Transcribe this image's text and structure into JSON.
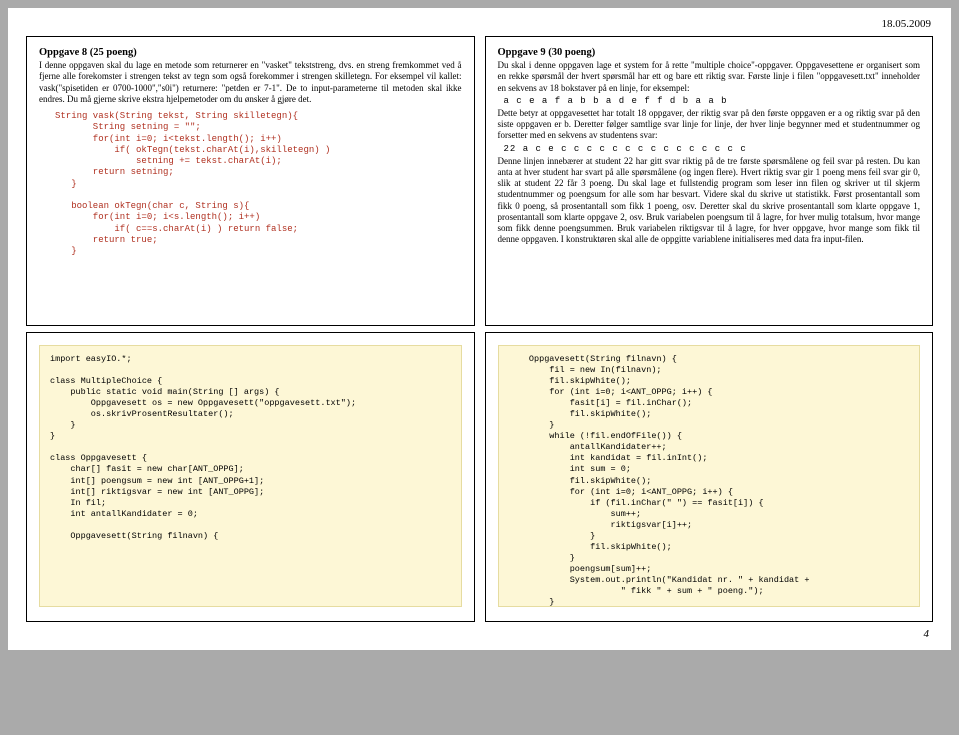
{
  "header": {
    "date": "18.05.2009"
  },
  "pagenum": "4",
  "slide8": {
    "title": "Oppgave 8 (25 poeng)",
    "para": "I denne oppgaven skal du lage en metode som returnerer en \"vasket\" tekststreng, dvs. en streng fremkommet ved å fjerne alle forekomster i strengen tekst av tegn som også forekommer i strengen skilletegn. For eksempel vil kallet: vask(\"spisetiden er 0700-1000\",\"s0i\") returnere: \"petden er 7-1\". De to input-parameterne til metoden skal ikke endres. Du må gjerne skrive ekstra hjelpemetoder om du ønsker å gjøre det.",
    "code": "String vask(String tekst, String skilletegn){\n       String setning = \"\";\n       for(int i=0; i<tekst.length(); i++)\n           if( okTegn(tekst.charAt(i),skilletegn) )\n               setning += tekst.charAt(i);\n       return setning;\n   }\n\n   boolean okTegn(char c, String s){\n       for(int i=0; i<s.length(); i++)\n           if( c==s.charAt(i) ) return false;\n       return true;\n   }"
  },
  "slide9": {
    "title": "Oppgave 9  (30 poeng)",
    "p1": "Du skal i denne oppgaven lage et system for å rette \"multiple choice\"-oppgaver. Oppgavesettene er organisert som en rekke spørsmål der hvert spørsmål har ett og bare ett riktig svar. Første linje i filen \"oppgavesett.txt\" inneholder en sekvens av 18 bokstaver på en linje, for eksempel:",
    "seq1": "a c e a f a b b a d e f f d b a a b",
    "p2": "Dette betyr at oppgavesettet har totalt 18 oppgaver, der riktig svar på den første oppgaven er a og riktig svar på den siste oppgaven er b. Deretter følger samtlige svar linje for linje, der hver linje begynner med et studentnummer og forsetter med en sekvens av studentens svar:",
    "seq2": " 22 a c e c c c c c c c c c c c c c c c",
    "p3": "Denne linjen innebærer at student 22 har gitt svar riktig på de tre første spørsmålene og feil svar på resten. Du kan anta at hver student har svart på alle spørsmålene (og ingen flere). Hvert riktig svar gir 1 poeng mens feil svar gir 0, slik at student 22 får 3 poeng. Du skal lage et fullstendig program som leser inn filen og skriver ut til skjerm studentnummer og poengsum for alle som har besvart. Videre skal du skrive ut statistikk. Først prosentantall som fikk 0 poeng, så prosentantall som fikk 1 poeng, osv. Deretter skal du skrive prosentantall som klarte oppgave 1, prosentantall som klarte oppgave 2, osv. Bruk variabelen poengsum til å lagre, for hver mulig totalsum, hvor mange som fikk denne poengsummen. Bruk variabelen riktigsvar  til å lagre, for hver oppgave, hvor mange som fikk til denne oppgaven. I konstruktøren skal alle de oppgitte variablene initialiseres med data fra input-filen."
  },
  "code3": "import easyIO.*;\n\nclass MultipleChoice {\n    public static void main(String [] args) {\n        Oppgavesett os = new Oppgavesett(\"oppgavesett.txt\");\n        os.skrivProsentResultater();\n    }\n}\n\nclass Oppgavesett {\n    char[] fasit = new char[ANT_OPPG];\n    int[] poengsum = new int [ANT_OPPG+1];\n    int[] riktigsvar = new int [ANT_OPPG];\n    In fil;\n    int antallKandidater = 0;\n\n    Oppgavesett(String filnavn) {",
  "code4": "    Oppgavesett(String filnavn) {\n        fil = new In(filnavn);\n        fil.skipWhite();\n        for (int i=0; i<ANT_OPPG; i++) {\n            fasit[i] = fil.inChar();\n            fil.skipWhite();\n        }\n        while (!fil.endOfFile()) {\n            antallKandidater++;\n            int kandidat = fil.inInt();\n            int sum = 0;\n            fil.skipWhite();\n            for (int i=0; i<ANT_OPPG; i++) {\n                if (fil.inChar(\" \") == fasit[i]) {\n                    sum++;\n                    riktigsvar[i]++;\n                }\n                fil.skipWhite();\n            }\n            poengsum[sum]++;\n            System.out.println(\"Kandidat nr. \" + kandidat +\n                      \" fikk \" + sum + \" poeng.\");\n        }\n    }"
}
